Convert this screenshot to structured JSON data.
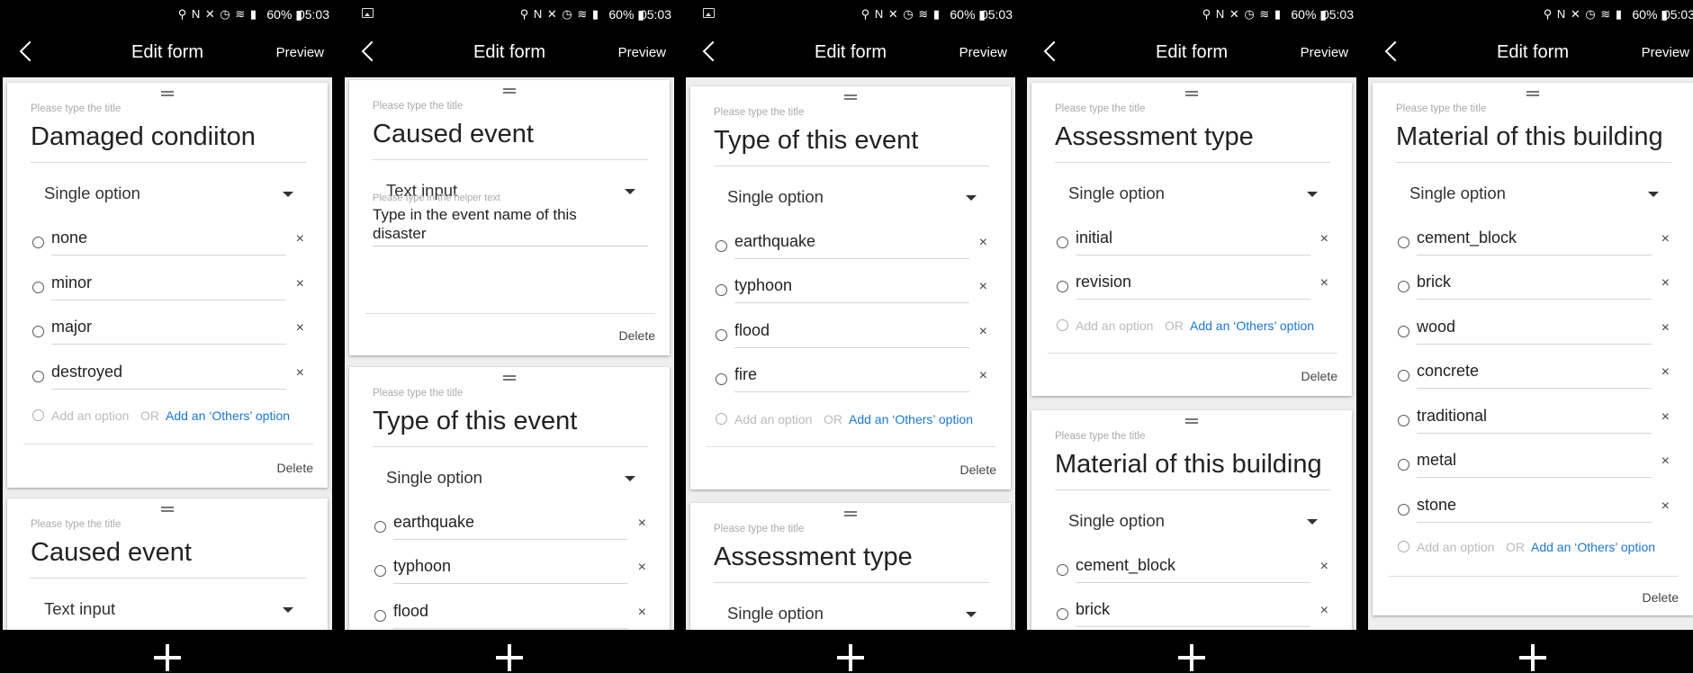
{
  "status": {
    "icons": "⚲ N ✕ ◷ ≋ ▮",
    "battery": "60% ▮",
    "time": "05:03"
  },
  "appbar": {
    "title": "Edit form",
    "preview": "Preview"
  },
  "common": {
    "title_hint": "Please type the title",
    "helper_hint": "Please type in the helper text",
    "add_option": "Add an option",
    "or": "OR",
    "add_others": "Add an ‘Others’ option",
    "delete": "Delete",
    "remove": "×"
  },
  "screens": [
    {
      "cards": [
        {
          "title": "Damaged condiiton",
          "type": "Single option",
          "options": [
            "none",
            "minor",
            "major",
            "destroyed"
          ]
        },
        {
          "title": "Caused event",
          "type": "Text input"
        }
      ]
    },
    {
      "cards": [
        {
          "title": "Caused event",
          "type": "Text input",
          "helper": "Type in the event name of this disaster"
        },
        {
          "title": "Type of this event",
          "type": "Single option",
          "options": [
            "earthquake",
            "typhoon",
            "flood"
          ]
        }
      ]
    },
    {
      "cards": [
        {
          "title": "Type of this event",
          "type": "Single option",
          "options": [
            "earthquake",
            "typhoon",
            "flood",
            "fire"
          ]
        },
        {
          "title": "Assessment type",
          "type": "Single option"
        }
      ]
    },
    {
      "cards": [
        {
          "title": "Assessment type",
          "type": "Single option",
          "options": [
            "initial",
            "revision"
          ]
        },
        {
          "title": "Material of this building",
          "type": "Single option",
          "options": [
            "cement_block",
            "brick"
          ]
        }
      ]
    },
    {
      "cards": [
        {
          "title": "Material of this building",
          "type": "Single option",
          "options": [
            "cement_block",
            "brick",
            "wood",
            "concrete",
            "traditional",
            "metal",
            "stone"
          ]
        }
      ]
    }
  ]
}
